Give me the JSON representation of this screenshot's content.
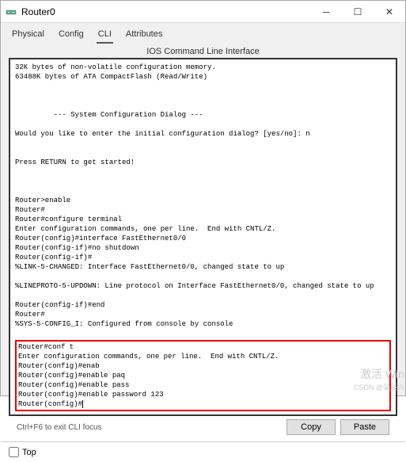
{
  "window": {
    "title": "Router0"
  },
  "tabs": {
    "items": [
      "Physical",
      "Config",
      "CLI",
      "Attributes"
    ],
    "active": 2
  },
  "subtitle": "IOS Command Line Interface",
  "terminal": {
    "lines": [
      "32K bytes of non-volatile configuration memory.",
      "63488K bytes of ATA CompactFlash (Read/Write)",
      "",
      "",
      "",
      "         --- System Configuration Dialog ---",
      "",
      "Would you like to enter the initial configuration dialog? [yes/no]: n",
      "",
      "",
      "Press RETURN to get started!",
      "",
      "",
      "",
      "Router>enable",
      "Router#",
      "Router#configure terminal",
      "Enter configuration commands, one per line.  End with CNTL/Z.",
      "Router(config)#interface FastEthernet0/0",
      "Router(config-if)#no shutdown",
      "Router(config-if)#",
      "%LINK-5-CHANGED: Interface FastEthernet0/0, changed state to up",
      "",
      "%LINEPROTO-5-UPDOWN: Line protocol on Interface FastEthernet0/0, changed state to up",
      "",
      "Router(config-if)#end",
      "Router#",
      "%SYS-5-CONFIG_I: Configured from console by console",
      ""
    ],
    "redbox_lines": [
      "Router#conf t",
      "Enter configuration commands, one per line.  End with CNTL/Z.",
      "Router(config)#enab",
      "Router(config)#enable paq",
      "Router(config)#enable pass",
      "Router(config)#enable password 123",
      "Router(config)#"
    ]
  },
  "hint": "Ctrl+F6 to exit CLI focus",
  "buttons": {
    "copy": "Copy",
    "paste": "Paste"
  },
  "footer": {
    "top_label": "Top"
  },
  "watermark": {
    "line1": "激活 Win",
    "line2": "CSDN @梁辰兴"
  }
}
